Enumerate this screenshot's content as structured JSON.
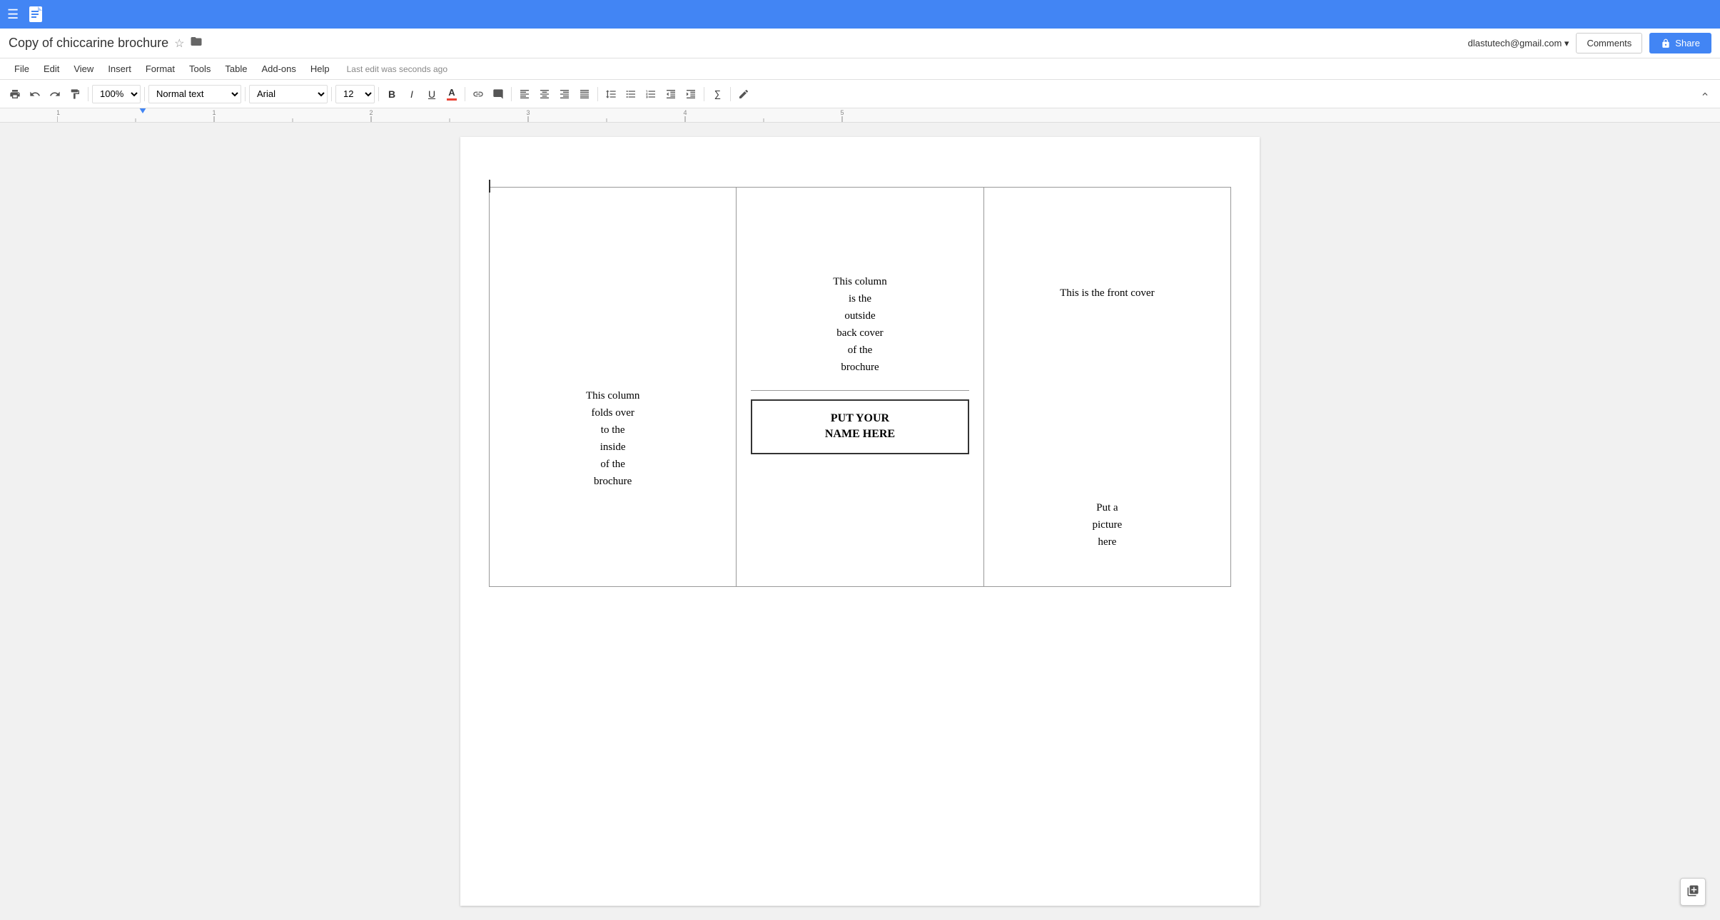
{
  "topbar": {
    "hamburger": "☰"
  },
  "titlebar": {
    "doc_title": "Copy of chiccarine brochure",
    "star_icon": "☆",
    "folder_icon": "📁",
    "user_email": "dlastutech@gmail.com ▾",
    "comments_label": "Comments",
    "share_label": "Share",
    "lock_icon": "🔒"
  },
  "menubar": {
    "items": [
      "File",
      "Edit",
      "View",
      "Insert",
      "Format",
      "Tools",
      "Table",
      "Add-ons",
      "Help"
    ],
    "last_edit": "Last edit was seconds ago"
  },
  "toolbar": {
    "zoom": "100%",
    "paragraph_style": "Normal text",
    "font": "Arial",
    "font_size": "12",
    "bold": "B",
    "italic": "I",
    "underline": "U"
  },
  "brochure": {
    "col1_text": "This column\nfolds over\nto the\ninside\nof the\nbrochure",
    "col2_top_text": "This column\nis the\noutside\nback cover\nof the\nbrochure",
    "col2_name_line1": "PUT YOUR",
    "col2_name_line2": "NAME HERE",
    "col3_front_cover": "This is the front cover",
    "col3_picture_line1": "Put a",
    "col3_picture_line2": "picture",
    "col3_picture_line3": "here"
  }
}
